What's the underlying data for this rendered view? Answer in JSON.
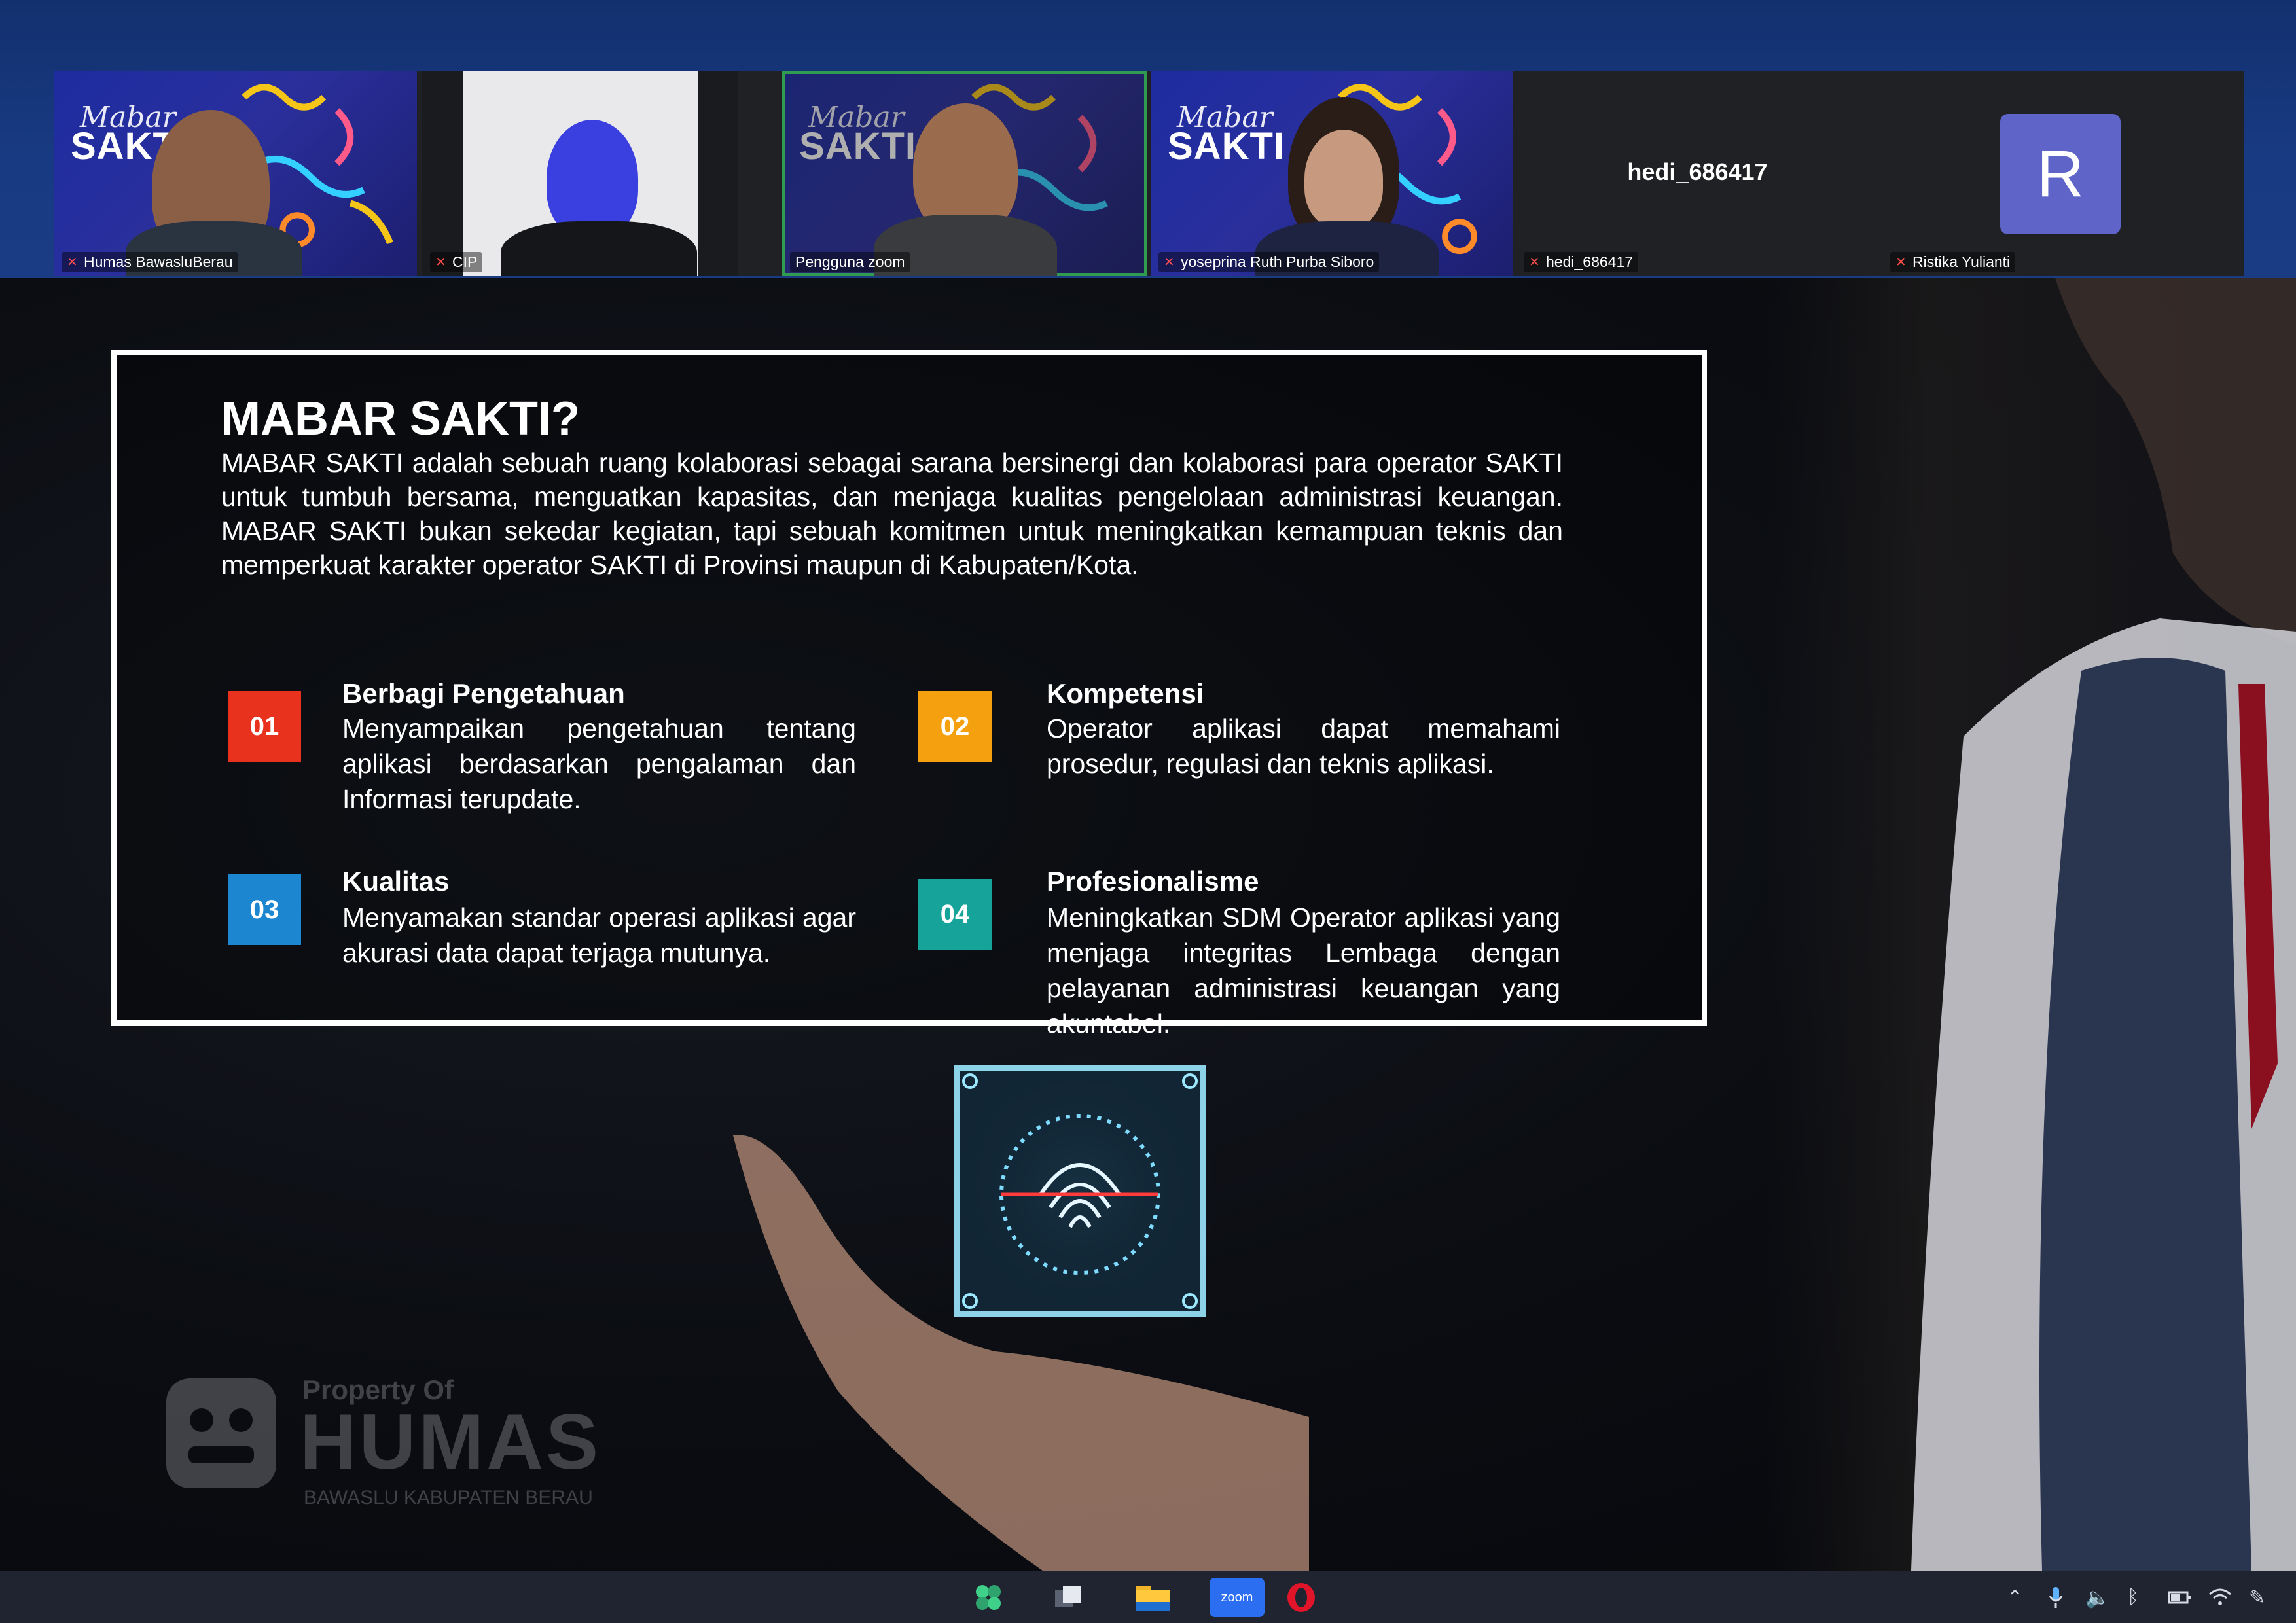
{
  "participants": [
    {
      "name": "Humas BawasluBerau",
      "muted": true
    },
    {
      "name": "CIP",
      "muted": true
    },
    {
      "name": "Pengguna zoom",
      "muted": false,
      "active_speaker": true
    },
    {
      "name": "yoseprina Ruth Purba Siboro",
      "muted": true
    },
    {
      "name": "hedi_686417",
      "muted": true,
      "display_title": "hedi_686417"
    },
    {
      "name": "Ristika Yulianti",
      "muted": true,
      "avatar_letter": "R"
    }
  ],
  "tile_branding": {
    "brand": "SAKTI",
    "script": "Mabar"
  },
  "slide": {
    "title": "MABAR SAKTI?",
    "intro": "MABAR SAKTI adalah sebuah ruang kolaborasi sebagai sarana bersinergi dan kolaborasi para operator SAKTI untuk tumbuh bersama, menguatkan kapasitas, dan menjaga kualitas pengelolaan administrasi keuangan. MABAR SAKTI bukan sekedar kegiatan, tapi sebuah komitmen untuk meningkatkan kemampuan teknis dan memperkuat karakter operator SAKTI di Provinsi maupun di Kabupaten/Kota.",
    "features": [
      {
        "number": "01",
        "title": "Berbagi Pengetahuan",
        "text": "Menyampaikan pengetahuan tentang aplikasi berdasarkan pengalaman dan Informasi terupdate.",
        "color": "#e8321e"
      },
      {
        "number": "02",
        "title": "Kompetensi",
        "text": "Operator aplikasi dapat memahami prosedur, regulasi dan teknis aplikasi.",
        "color": "#f5a10f"
      },
      {
        "number": "03",
        "title": "Kualitas",
        "text": "Menyamakan standar operasi aplikasi agar akurasi data dapat terjaga mutunya.",
        "color": "#1d86d0"
      },
      {
        "number": "04",
        "title": "Profesionalisme",
        "text": "Meningkatkan SDM Operator aplikasi yang menjaga integritas Lembaga dengan pelayanan administrasi keuangan yang akuntabel.",
        "color": "#16a39a"
      }
    ]
  },
  "watermark": {
    "line1": "Property Of",
    "line2": "HUMAS",
    "line3": "BAWASLU KABUPATEN BERAU"
  },
  "taskbar": {
    "apps": [
      "widgets-icon",
      "task-view-icon",
      "file-explorer-icon",
      "zoom-icon",
      "opera-icon"
    ],
    "zoom_label": "zoom",
    "tray": [
      "chevron-up-icon",
      "microphone-icon",
      "speaker-icon",
      "bluetooth-icon",
      "battery-icon",
      "wifi-icon",
      "pen-icon"
    ]
  },
  "colors": {
    "active_speaker": "#3ee06a",
    "avatar_bg": "#5e64c8",
    "zoom_bar": "#183a82"
  }
}
